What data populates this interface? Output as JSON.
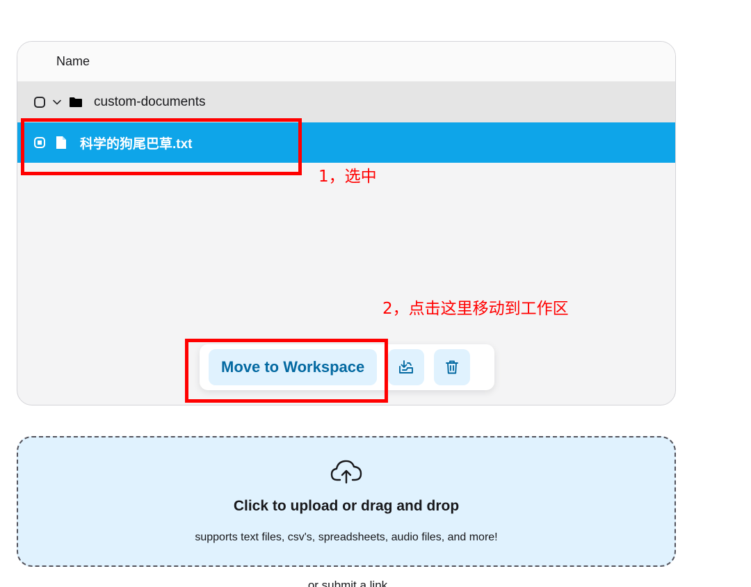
{
  "file_browser": {
    "column_header": "Name",
    "folder": {
      "name": "custom-documents"
    },
    "file": {
      "name": "科学的狗尾巴草.txt",
      "selected": true
    }
  },
  "actions": {
    "move_label": "Move to Workspace",
    "download_icon": "download-tray-icon",
    "delete_icon": "trash-icon"
  },
  "annotations": {
    "step1": "1，选中",
    "step2": "2，点击这里移动到工作区",
    "color": "#ff0000"
  },
  "upload": {
    "title": "Click to upload or drag and drop",
    "subtitle": "supports text files, csv's, spreadsheets, audio files, and more!",
    "submit_link": "or submit a link",
    "icon": "cloud-upload-icon"
  },
  "colors": {
    "selected_row": "#0ea5e9",
    "accent_light": "#e0f2fe",
    "accent_text": "#0369a1"
  }
}
